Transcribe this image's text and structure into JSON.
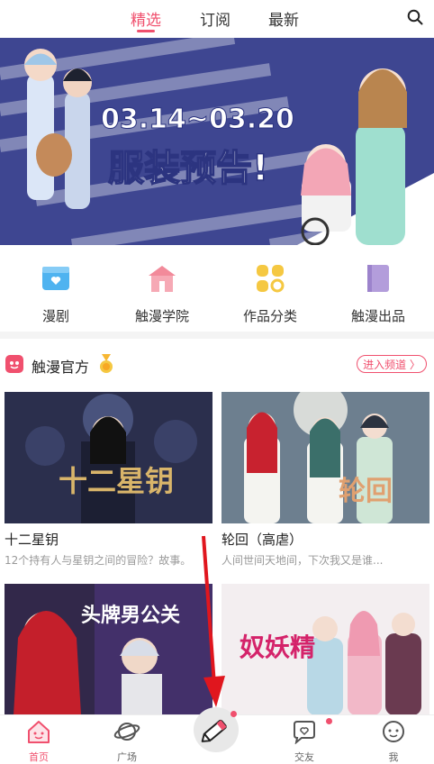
{
  "topbar": {
    "tabs": [
      "精选",
      "订阅",
      "最新"
    ],
    "active": "精选"
  },
  "banner": {
    "date_range": "03.14~03.20",
    "headline": "服装预告!",
    "dot_count": 5,
    "active_dot": 4
  },
  "quick": [
    {
      "label": "漫剧",
      "icon": "video-icon",
      "color": "#4fb3f0"
    },
    {
      "label": "触漫学院",
      "icon": "school-icon",
      "color": "#f28a9a"
    },
    {
      "label": "作品分类",
      "icon": "category-icon",
      "color": "#f5c842"
    },
    {
      "label": "触漫出品",
      "icon": "book-icon",
      "color": "#b39ddb"
    }
  ],
  "section": {
    "title": "触漫官方",
    "badge_icon": "medal-icon",
    "enter_label": "进入频道 〉"
  },
  "cards": [
    {
      "title": "十二星钥",
      "desc": "12个持有人与星钥之间的冒险？故事。",
      "cover_text": "十二星钥"
    },
    {
      "title": "轮回（高虐）",
      "desc": "人间世间天地间，下次我又是谁...",
      "cover_text": "轮回"
    },
    {
      "title": "",
      "desc": "",
      "cover_text": "头牌男公关"
    },
    {
      "title": "",
      "desc": "",
      "cover_text": "奴妖精"
    }
  ],
  "bottom_nav": [
    {
      "label": "首页",
      "icon": "home-icon",
      "active": true
    },
    {
      "label": "广场",
      "icon": "planet-icon",
      "active": false
    },
    {
      "label": "交友",
      "icon": "chat-heart-icon",
      "active": false
    },
    {
      "label": "我",
      "icon": "face-icon",
      "active": false
    }
  ],
  "colors": {
    "accent": "#f0506e",
    "banner_bg": "#3e4691"
  }
}
